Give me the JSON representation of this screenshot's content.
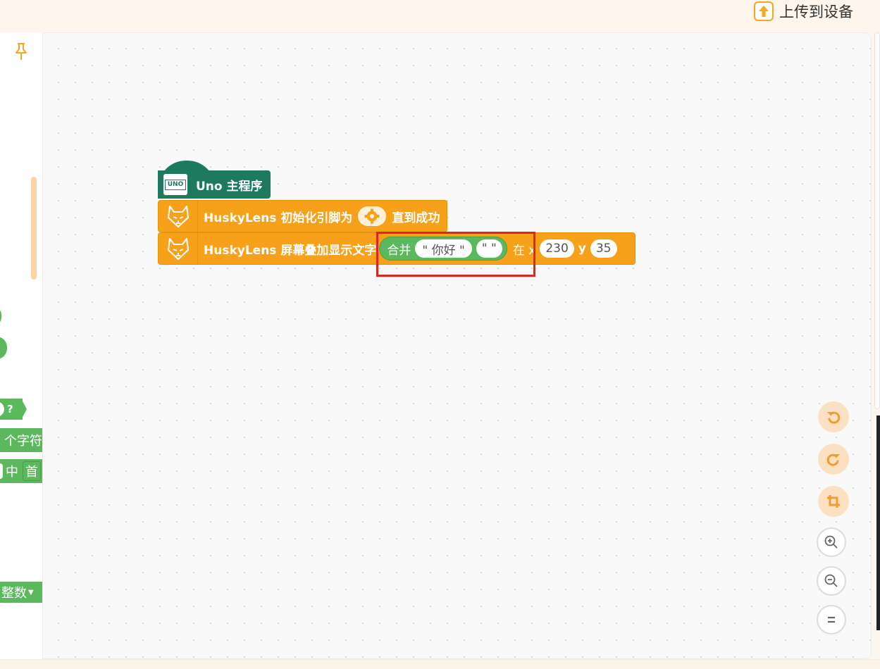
{
  "topbar": {
    "upload_label": "上传到设备",
    "upload_icon": "upload-arrow-icon"
  },
  "flyout": {
    "pin_icon": "pin-icon",
    "items": [
      {
        "label": "?"
      },
      {
        "label": "个字符"
      },
      {
        "label": "中"
      },
      {
        "label": "首"
      },
      {
        "label": "整数"
      }
    ]
  },
  "workspace": {
    "uno_block": {
      "label": "Uno 主程序",
      "chip_text": "UNO"
    },
    "init_block": {
      "label": "HuskyLens 初始化引脚为",
      "suffix": "直到成功"
    },
    "display_block": {
      "label": "HuskyLens 屏幕叠加显示文字",
      "join_label": "合并",
      "str1": "\" 你好 \"",
      "str2": "\"   \"",
      "at_label": "在 x",
      "x_value": "230",
      "y_label": "y",
      "y_value": "35"
    }
  },
  "controls": [
    "undo-icon",
    "redo-icon",
    "crop-icon",
    "zoom-in-icon",
    "zoom-out-icon",
    "reset-zoom-icon"
  ],
  "colors": {
    "uno_green": "#1d7a5f",
    "huskylens_orange": "#f7a11a",
    "text_green": "#5bb85d",
    "highlight_red": "#e0251c"
  }
}
